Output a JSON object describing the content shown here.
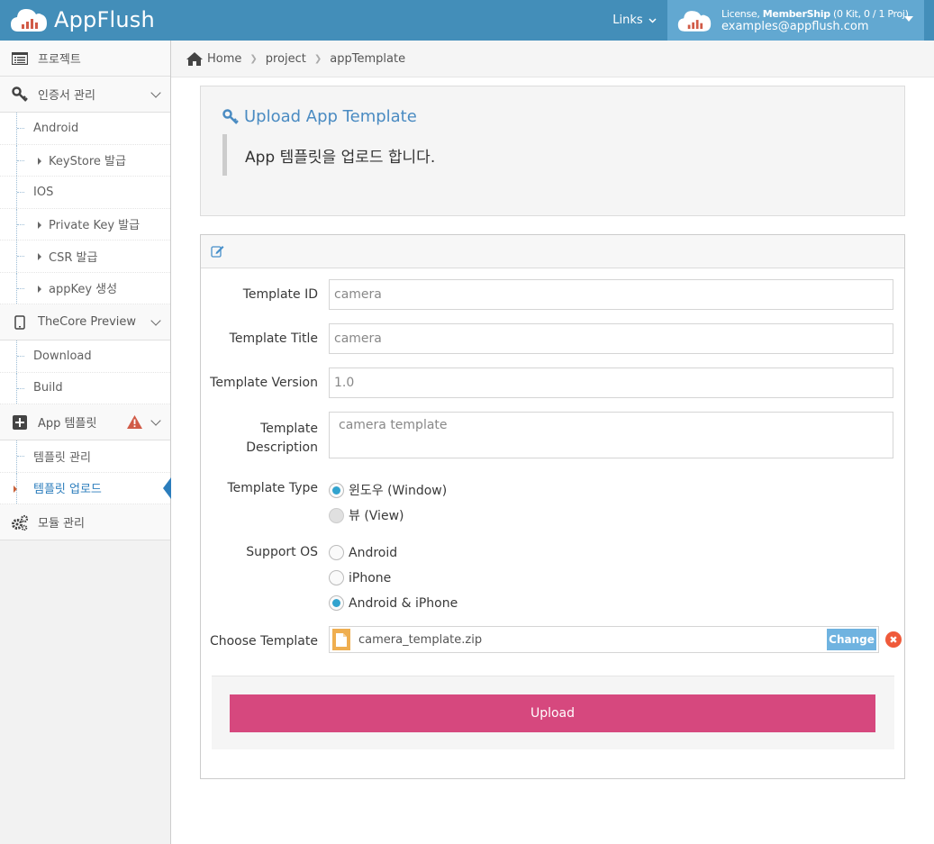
{
  "brand": {
    "name": "AppFlush"
  },
  "topbar": {
    "links_label": "Links",
    "license_prefix": "License, ",
    "license_type": "MemberShip",
    "license_detail": " (0 Kit, 0 / 1 Proj)",
    "email": "examples@appflush.com"
  },
  "sidebar": {
    "project": "프로젝트",
    "cert": "인증서 관리",
    "android": "Android",
    "keystore": "KeyStore 발급",
    "ios": "IOS",
    "private_key": "Private Key 발급",
    "csr": "CSR 발급",
    "appkey": "appKey 생성",
    "thecore": "TheCore Preview",
    "download": "Download",
    "build": "Build",
    "app_template": "App 템플릿",
    "template_manage": "템플릿 관리",
    "template_upload": "템플릿 업로드",
    "module_manage": "모듈 관리"
  },
  "breadcrumb": {
    "home": "Home",
    "project": "project",
    "current": "appTemplate"
  },
  "header": {
    "title": "Upload App Template",
    "description": "App 템플릿을 업로드 합니다."
  },
  "form": {
    "template_id_label": "Template ID",
    "template_id_value": "camera",
    "template_title_label": "Template Title",
    "template_title_value": "camera",
    "template_version_label": "Template Version",
    "template_version_value": "1.0",
    "template_desc_label_1": "Template",
    "template_desc_label_2": "Description",
    "template_desc_value": "camera template",
    "template_type_label": "Template Type",
    "type_window": "윈도우 (Window)",
    "type_view": "뷰 (View)",
    "support_os_label": "Support OS",
    "os_android": "Android",
    "os_iphone": "iPhone",
    "os_both": "Android & iPhone",
    "choose_template_label": "Choose Template",
    "file_name": "camera_template.zip",
    "change_label": "Change",
    "upload_label": "Upload"
  },
  "colors": {
    "topbar": "#438eb9",
    "user_box": "#62a8d1",
    "accent": "#4a8bc2",
    "upload_button": "#d6487e",
    "warning": "#d15b47"
  }
}
